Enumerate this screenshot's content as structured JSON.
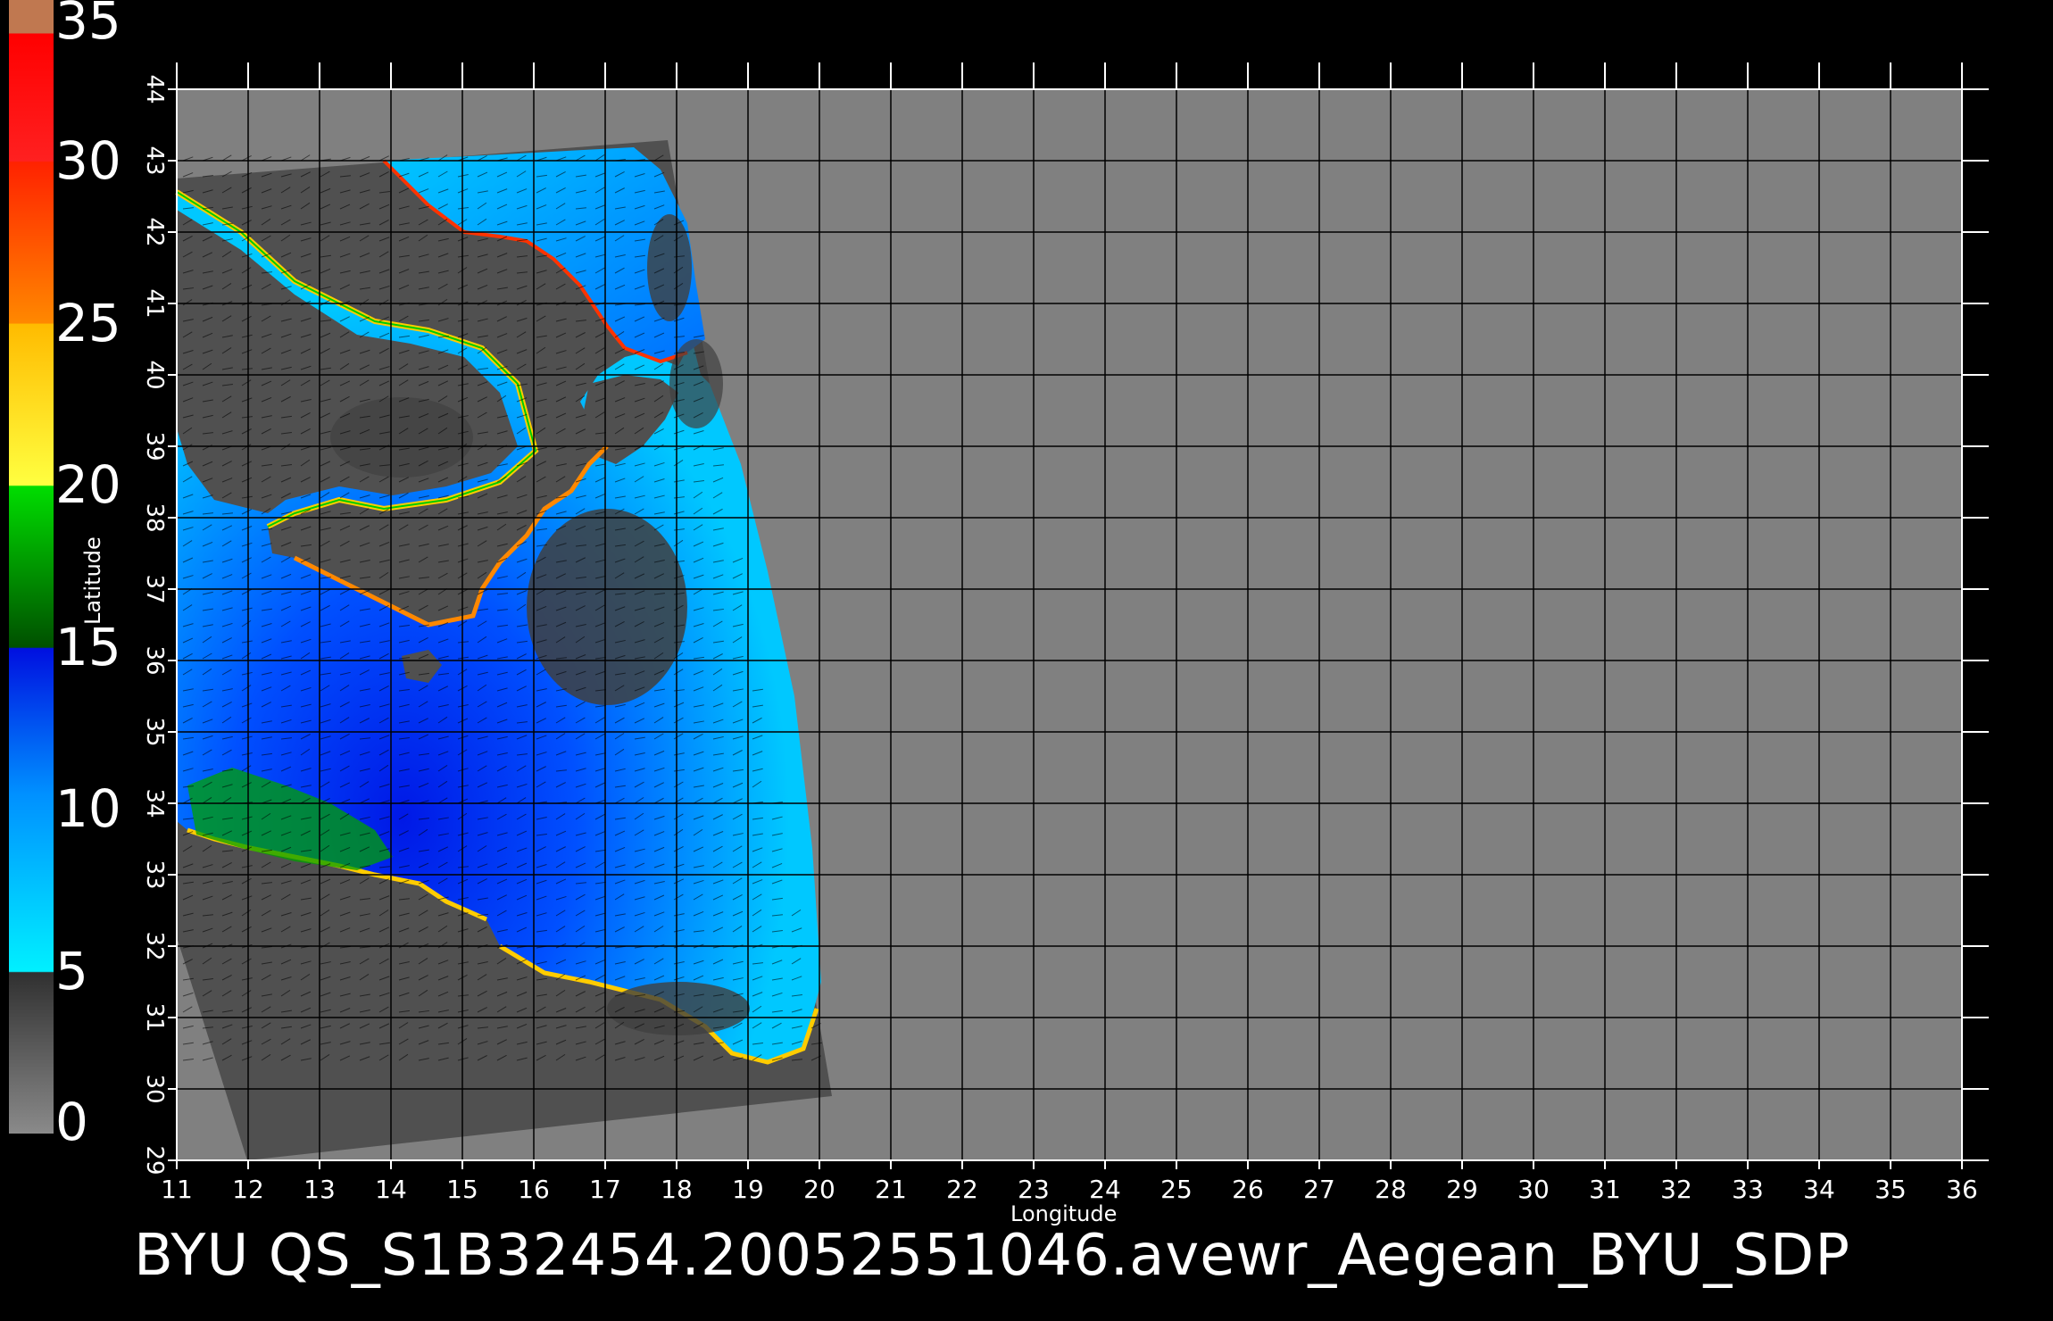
{
  "colorbar": {
    "labels": [
      "35",
      "30",
      "25",
      "20",
      "15",
      "10",
      "5",
      "0"
    ],
    "stops": [
      {
        "range": [
          0,
          5
        ],
        "colors": [
          "#808080",
          "#3a3a3a"
        ]
      },
      {
        "range": [
          5,
          15
        ],
        "colors": [
          "#00f0ff",
          "#0060ff",
          "#0010e0"
        ]
      },
      {
        "range": [
          15,
          20
        ],
        "colors": [
          "#006600",
          "#00cc00"
        ]
      },
      {
        "range": [
          20,
          25
        ],
        "colors": [
          "#ffff30",
          "#ffcc00"
        ]
      },
      {
        "range": [
          25,
          30
        ],
        "colors": [
          "#ff9900",
          "#ff3300"
        ]
      },
      {
        "range": [
          30,
          34
        ],
        "colors": [
          "#ff2020",
          "#ff0000"
        ]
      },
      {
        "range": [
          34,
          35
        ],
        "colors": [
          "#c07850"
        ]
      }
    ]
  },
  "chart_data": {
    "type": "heatmap",
    "xlabel": "Longitude",
    "ylabel": "Latitude",
    "xlim": [
      11,
      36
    ],
    "ylim": [
      29,
      44
    ],
    "x_ticks": [
      "11",
      "12",
      "13",
      "14",
      "15",
      "16",
      "17",
      "18",
      "19",
      "20",
      "21",
      "22",
      "23",
      "24",
      "25",
      "26",
      "27",
      "28",
      "29",
      "30",
      "31",
      "32",
      "33",
      "34",
      "35",
      "36"
    ],
    "y_ticks": [
      "29",
      "30",
      "31",
      "32",
      "33",
      "34",
      "35",
      "36",
      "37",
      "38",
      "39",
      "40",
      "41",
      "42",
      "43",
      "44"
    ],
    "value_range": [
      0,
      35
    ],
    "grid": true
  },
  "footer": {
    "title": "BYU  QS_S1B32454.20052551046.avewr_Aegean_BYU_SDP"
  },
  "colors": {
    "background": "#000000",
    "no_data": "#808080",
    "swath_land": "#505050",
    "grid": "#000000"
  }
}
